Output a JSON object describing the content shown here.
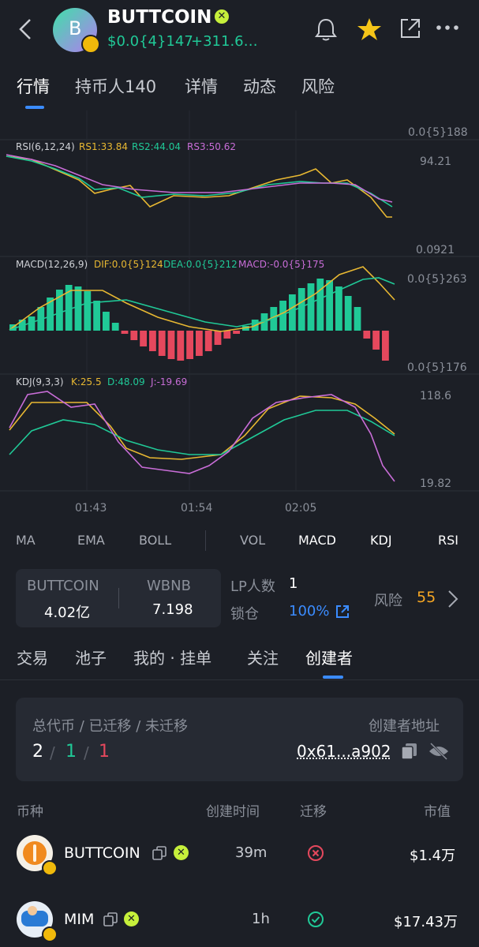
{
  "header": {
    "token_name": "BUTTCOIN",
    "avatar_letter": "B",
    "price": "$0.0{4}147",
    "change": "+311.6…"
  },
  "tabs": [
    "行情",
    "持币人140",
    "详情",
    "动态",
    "风险"
  ],
  "chart": {
    "top_price_label": "0.0{5}188",
    "rsi": {
      "title": "RSI(6,12,24)",
      "rs1": "RS1:33.84",
      "rs2": "RS2:44.04",
      "rs3": "RS3:50.62",
      "axis_top": "94.21",
      "axis_bottom": "0.0921"
    },
    "macd": {
      "title": "MACD(12,26,9)",
      "dif": "DIF:0.0{5}124",
      "dea": "DEA:0.0{5}212",
      "macd": "MACD:-0.0{5}175",
      "axis_top": "0.0{5}263",
      "axis_bottom": "0.0{5}176"
    },
    "kdj": {
      "title": "KDJ(9,3,3)",
      "k": "K:25.5",
      "d": "D:48.09",
      "j": "J:-19.69",
      "axis_top": "118.6",
      "axis_bottom": "19.82"
    },
    "time_labels": [
      "01:43",
      "01:54",
      "02:05"
    ]
  },
  "indicators": {
    "left": [
      "MA",
      "EMA",
      "BOLL"
    ],
    "right": [
      "VOL",
      "MACD",
      "KDJ",
      "RSI"
    ]
  },
  "pool": {
    "token_a_label": "BUTTCOIN",
    "token_a_value": "4.02亿",
    "token_b_label": "WBNB",
    "token_b_value": "7.198",
    "lp_label": "LP人数",
    "lp_value": "1",
    "lock_label": "锁仓",
    "lock_value": "100%",
    "risk_label": "风险",
    "risk_value": "55"
  },
  "subtabs": [
    "交易",
    "池子",
    "我的 · 挂单",
    "关注",
    "创建者"
  ],
  "creator": {
    "stats_label": "总代币 / 已迁移 / 未迁移",
    "total": "2",
    "migrated": "1",
    "not_migrated": "1",
    "sep": "/",
    "address_label": "创建者地址",
    "address": "0x61...a902"
  },
  "table": {
    "headers": [
      "币种",
      "创建时间",
      "迁移",
      "市值"
    ],
    "rows": [
      {
        "name": "BUTTCOIN",
        "time": "39m",
        "migrated": false,
        "mcap": "$1.4万"
      },
      {
        "name": "MIM",
        "time": "1h",
        "migrated": true,
        "mcap": "$17.43万"
      }
    ]
  },
  "colors": {
    "green": "#20c997",
    "red": "#e5485d",
    "yellow": "#e8b832",
    "purple": "#c86dd7",
    "accent_blue": "#3b8cff",
    "star": "#f5c518"
  }
}
